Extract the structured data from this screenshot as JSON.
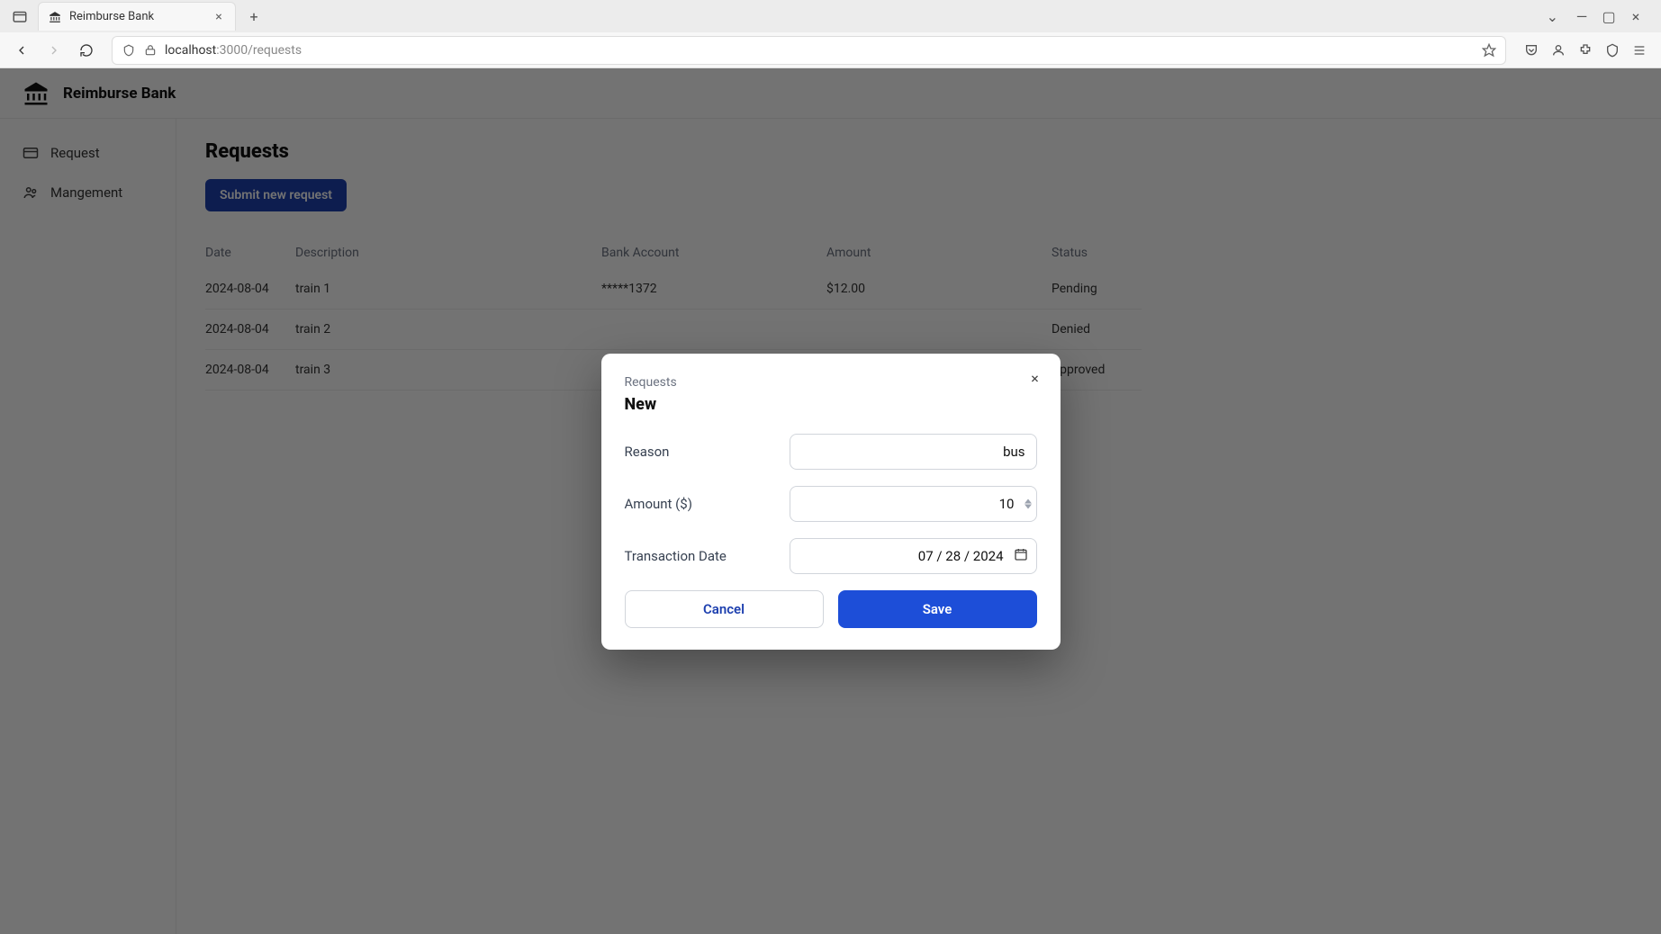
{
  "browser": {
    "tab_title": "Reimburse Bank",
    "url_host": "localhost",
    "url_port_path": ":3000/requests",
    "new_tab": "+",
    "close": "×",
    "chevron": "⌄",
    "minimize": "—",
    "maximize": "▢",
    "win_close": "×"
  },
  "app": {
    "title": "Reimburse Bank"
  },
  "sidebar": {
    "items": [
      {
        "label": "Request"
      },
      {
        "label": "Mangement"
      }
    ]
  },
  "page": {
    "title": "Requests",
    "submit_label": "Submit new request"
  },
  "table": {
    "headers": {
      "date": "Date",
      "description": "Description",
      "bank_account": "Bank Account",
      "amount": "Amount",
      "status": "Status"
    },
    "rows": [
      {
        "date": "2024-08-04",
        "description": "train 1",
        "bank_account": "*****1372",
        "amount": "$12.00",
        "status": "Pending"
      },
      {
        "date": "2024-08-04",
        "description": "train 2",
        "bank_account": "",
        "amount": "",
        "status": "Denied"
      },
      {
        "date": "2024-08-04",
        "description": "train 3",
        "bank_account": "",
        "amount": "",
        "status": "Approved"
      }
    ]
  },
  "modal": {
    "eyebrow": "Requests",
    "title": "New",
    "close": "×",
    "reason_label": "Reason",
    "reason_value": "bus",
    "amount_label": "Amount ($)",
    "amount_value": "10",
    "date_label": "Transaction Date",
    "date_value": "07 / 28 / 2024",
    "cancel_label": "Cancel",
    "save_label": "Save"
  }
}
